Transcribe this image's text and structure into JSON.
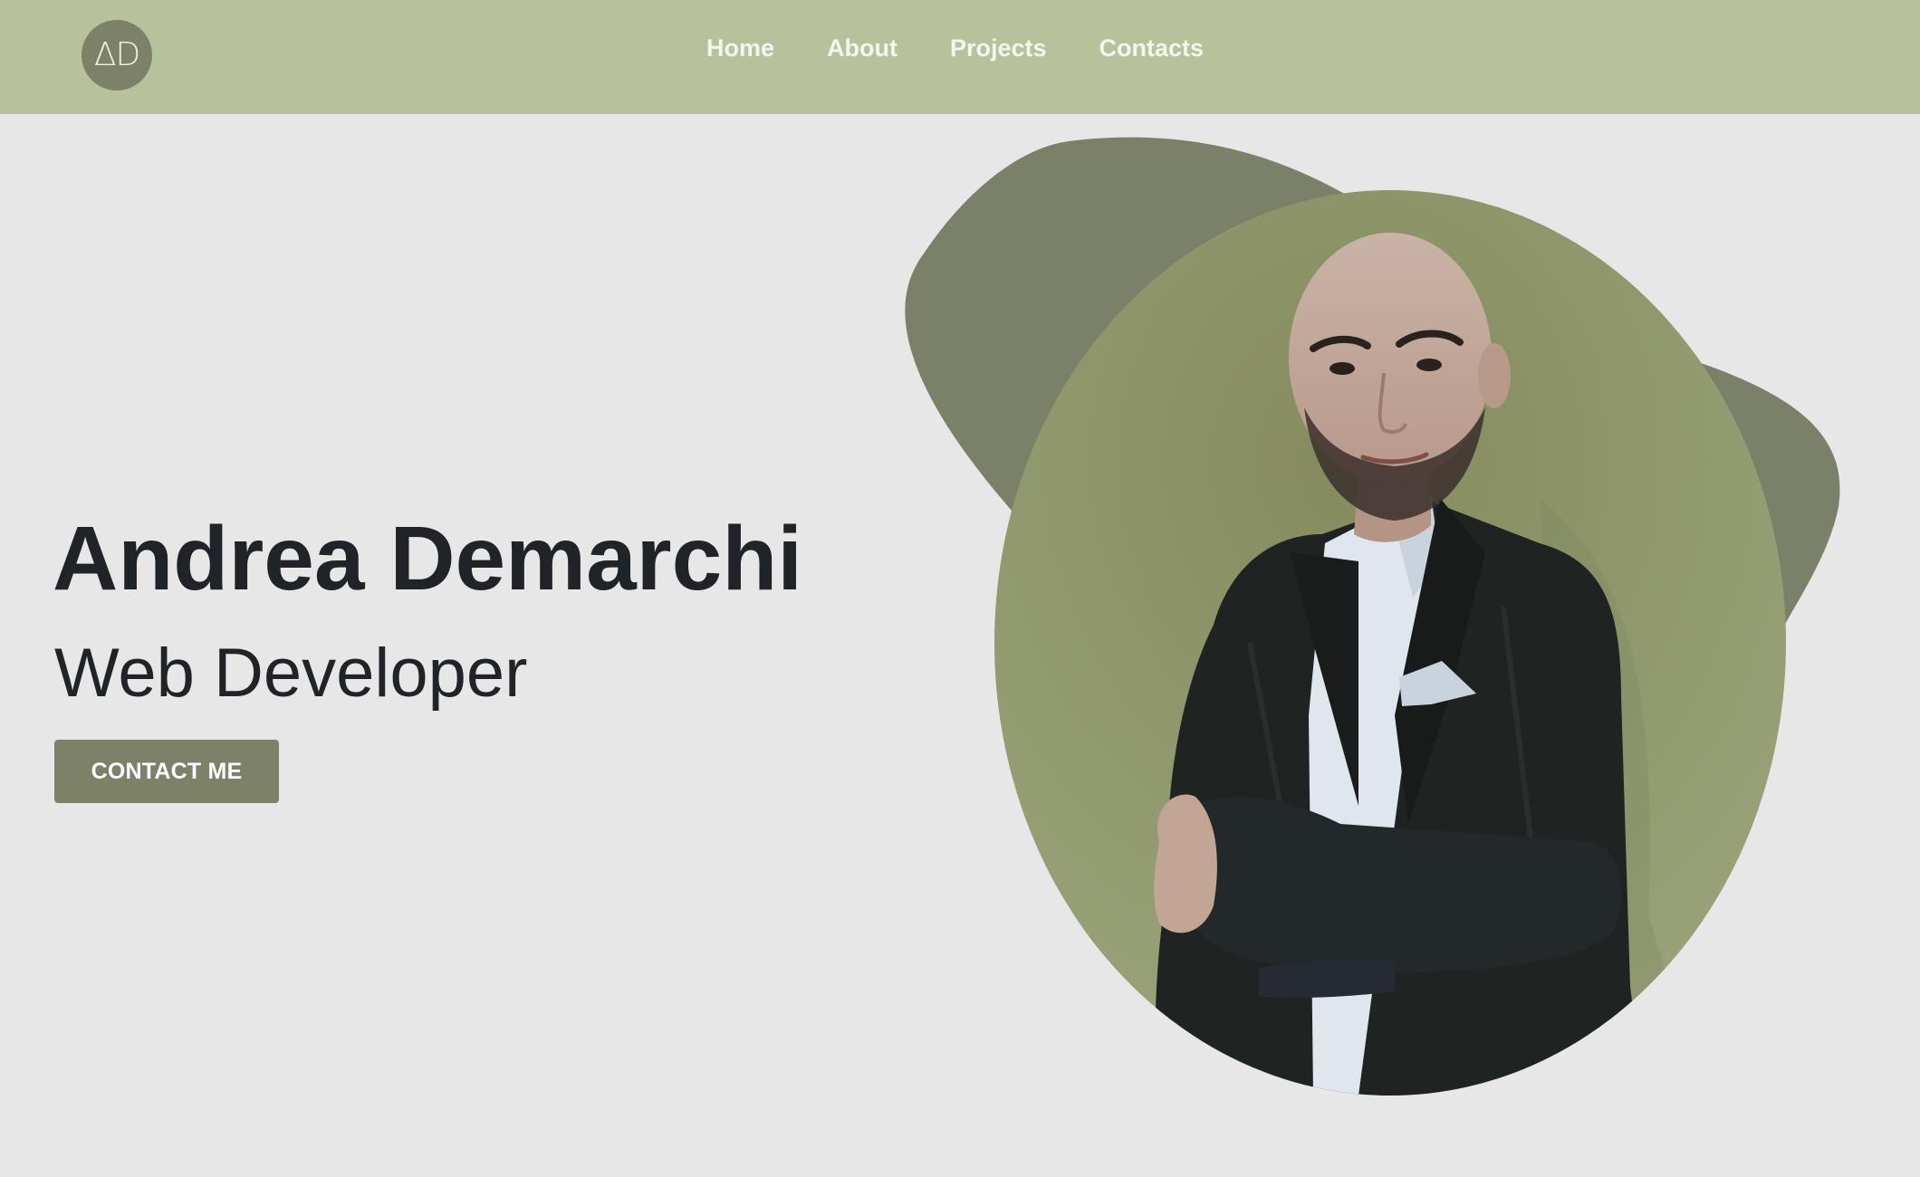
{
  "header": {
    "logo_text": "ΔD",
    "nav": [
      {
        "label": "Home"
      },
      {
        "label": "About"
      },
      {
        "label": "Projects"
      },
      {
        "label": "Contacts"
      }
    ]
  },
  "hero": {
    "name": "Andrea Demarchi",
    "role": "Web Developer",
    "cta_label": "CONTACT ME"
  },
  "colors": {
    "header_bg": "#b7c29d",
    "page_bg": "#e7e7e7",
    "accent": "#7c8168",
    "blob_dark": "#7a8168",
    "blob_light": "#9aa37a",
    "text_dark": "#202327"
  }
}
